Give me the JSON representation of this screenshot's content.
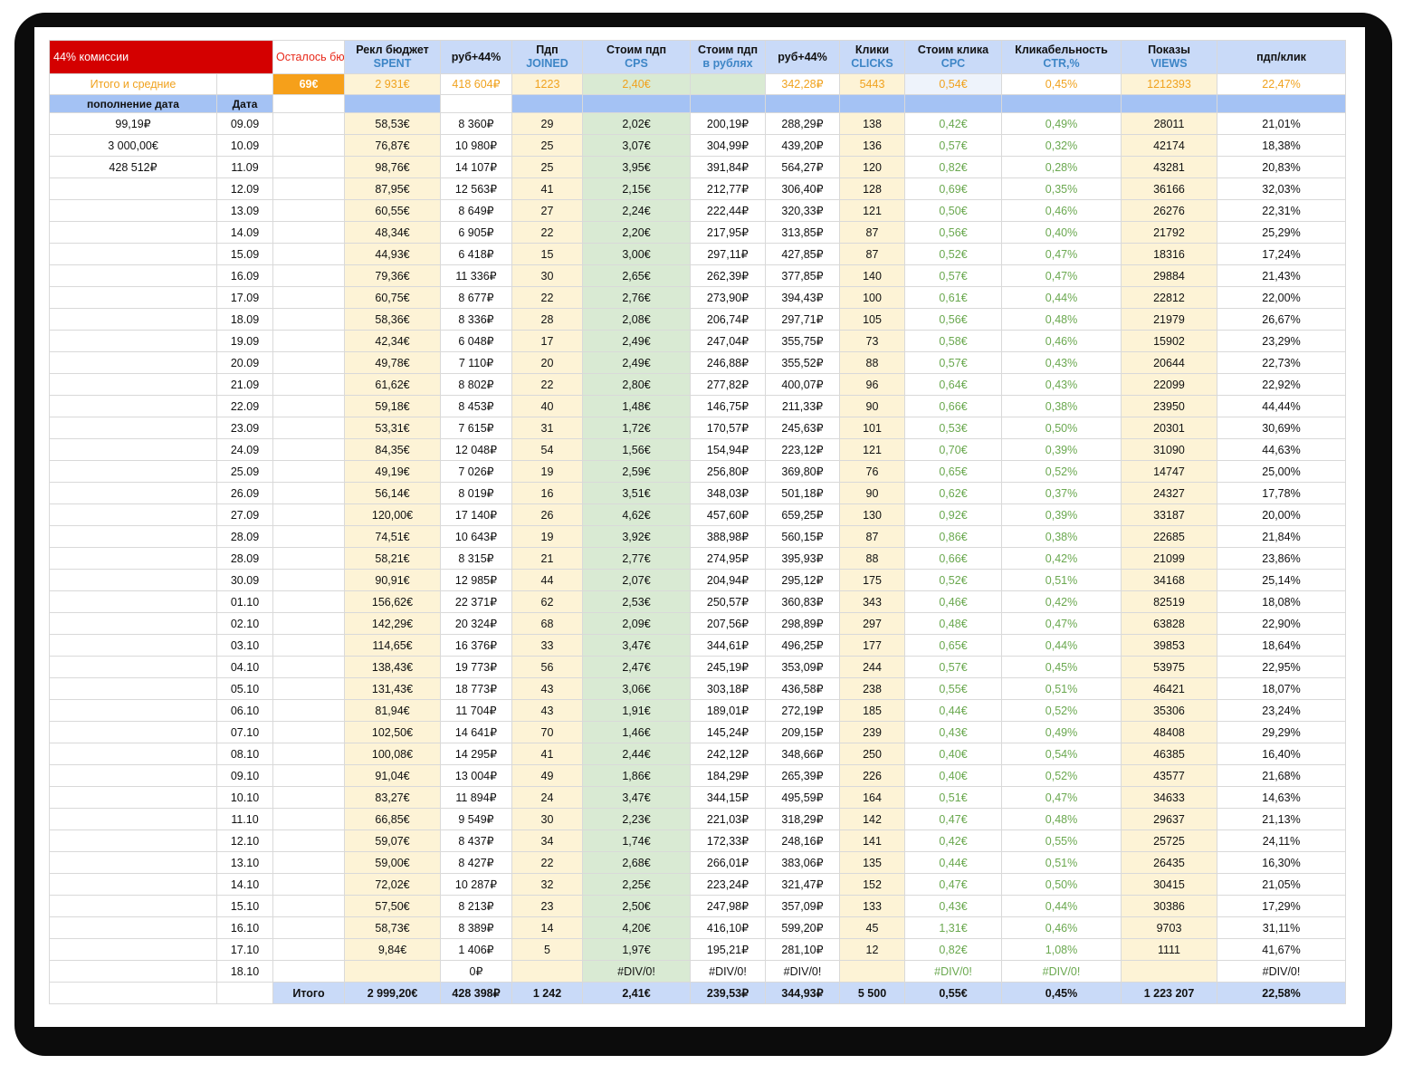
{
  "header": {
    "commission": "44% комиссии",
    "remain": "Осталось бюджета",
    "spent": {
      "ru": "Рекл бюджет",
      "en": "SPENT"
    },
    "rub44": "руб+44%",
    "joined": {
      "ru": "Пдп",
      "en": "JOINED"
    },
    "cps": {
      "ru": "Стоим пдп",
      "en": "CPS"
    },
    "cps_rub": {
      "ru": "Стоим пдп",
      "en": "в рублях"
    },
    "rub44b": "руб+44%",
    "clicks": {
      "ru": "Клики",
      "en": "CLICKS"
    },
    "cpc": {
      "ru": "Стоим клика",
      "en": "CPC"
    },
    "ctr": {
      "ru": "Кликабельность",
      "en": "CTR,%"
    },
    "views": {
      "ru": "Показы",
      "en": "VIEWS"
    },
    "per_click": "пдп/клик"
  },
  "totals_row": {
    "label": "Итого и средние",
    "remain": "69€",
    "spent": "2 931€",
    "rub44": "418 604₽",
    "joined": "1223",
    "cps": "2,40€",
    "cps_rub": "",
    "rub44b": "342,28₽",
    "clicks": "5443",
    "cpc": "0,54€",
    "ctr": "0,45%",
    "views": "1212393",
    "per_click": "22,47%"
  },
  "subheader": {
    "topup": "пополнение дата",
    "date": "Дата"
  },
  "topups": [
    "99,19₽",
    "3 000,00€",
    "428 512₽"
  ],
  "rows": [
    [
      "09.09",
      "58,53€",
      "8 360₽",
      "29",
      "2,02€",
      "200,19₽",
      "288,29₽",
      "138",
      "0,42€",
      "0,49%",
      "28011",
      "21,01%"
    ],
    [
      "10.09",
      "76,87€",
      "10 980₽",
      "25",
      "3,07€",
      "304,99₽",
      "439,20₽",
      "136",
      "0,57€",
      "0,32%",
      "42174",
      "18,38%"
    ],
    [
      "11.09",
      "98,76€",
      "14 107₽",
      "25",
      "3,95€",
      "391,84₽",
      "564,27₽",
      "120",
      "0,82€",
      "0,28%",
      "43281",
      "20,83%"
    ],
    [
      "12.09",
      "87,95€",
      "12 563₽",
      "41",
      "2,15€",
      "212,77₽",
      "306,40₽",
      "128",
      "0,69€",
      "0,35%",
      "36166",
      "32,03%"
    ],
    [
      "13.09",
      "60,55€",
      "8 649₽",
      "27",
      "2,24€",
      "222,44₽",
      "320,33₽",
      "121",
      "0,50€",
      "0,46%",
      "26276",
      "22,31%"
    ],
    [
      "14.09",
      "48,34€",
      "6 905₽",
      "22",
      "2,20€",
      "217,95₽",
      "313,85₽",
      "87",
      "0,56€",
      "0,40%",
      "21792",
      "25,29%"
    ],
    [
      "15.09",
      "44,93€",
      "6 418₽",
      "15",
      "3,00€",
      "297,11₽",
      "427,85₽",
      "87",
      "0,52€",
      "0,47%",
      "18316",
      "17,24%"
    ],
    [
      "16.09",
      "79,36€",
      "11 336₽",
      "30",
      "2,65€",
      "262,39₽",
      "377,85₽",
      "140",
      "0,57€",
      "0,47%",
      "29884",
      "21,43%"
    ],
    [
      "17.09",
      "60,75€",
      "8 677₽",
      "22",
      "2,76€",
      "273,90₽",
      "394,43₽",
      "100",
      "0,61€",
      "0,44%",
      "22812",
      "22,00%"
    ],
    [
      "18.09",
      "58,36€",
      "8 336₽",
      "28",
      "2,08€",
      "206,74₽",
      "297,71₽",
      "105",
      "0,56€",
      "0,48%",
      "21979",
      "26,67%"
    ],
    [
      "19.09",
      "42,34€",
      "6 048₽",
      "17",
      "2,49€",
      "247,04₽",
      "355,75₽",
      "73",
      "0,58€",
      "0,46%",
      "15902",
      "23,29%"
    ],
    [
      "20.09",
      "49,78€",
      "7 110₽",
      "20",
      "2,49€",
      "246,88₽",
      "355,52₽",
      "88",
      "0,57€",
      "0,43%",
      "20644",
      "22,73%"
    ],
    [
      "21.09",
      "61,62€",
      "8 802₽",
      "22",
      "2,80€",
      "277,82₽",
      "400,07₽",
      "96",
      "0,64€",
      "0,43%",
      "22099",
      "22,92%"
    ],
    [
      "22.09",
      "59,18€",
      "8 453₽",
      "40",
      "1,48€",
      "146,75₽",
      "211,33₽",
      "90",
      "0,66€",
      "0,38%",
      "23950",
      "44,44%"
    ],
    [
      "23.09",
      "53,31€",
      "7 615₽",
      "31",
      "1,72€",
      "170,57₽",
      "245,63₽",
      "101",
      "0,53€",
      "0,50%",
      "20301",
      "30,69%"
    ],
    [
      "24.09",
      "84,35€",
      "12 048₽",
      "54",
      "1,56€",
      "154,94₽",
      "223,12₽",
      "121",
      "0,70€",
      "0,39%",
      "31090",
      "44,63%"
    ],
    [
      "25.09",
      "49,19€",
      "7 026₽",
      "19",
      "2,59€",
      "256,80₽",
      "369,80₽",
      "76",
      "0,65€",
      "0,52%",
      "14747",
      "25,00%"
    ],
    [
      "26.09",
      "56,14€",
      "8 019₽",
      "16",
      "3,51€",
      "348,03₽",
      "501,18₽",
      "90",
      "0,62€",
      "0,37%",
      "24327",
      "17,78%"
    ],
    [
      "27.09",
      "120,00€",
      "17 140₽",
      "26",
      "4,62€",
      "457,60₽",
      "659,25₽",
      "130",
      "0,92€",
      "0,39%",
      "33187",
      "20,00%"
    ],
    [
      "28.09",
      "74,51€",
      "10 643₽",
      "19",
      "3,92€",
      "388,98₽",
      "560,15₽",
      "87",
      "0,86€",
      "0,38%",
      "22685",
      "21,84%"
    ],
    [
      "28.09",
      "58,21€",
      "8 315₽",
      "21",
      "2,77€",
      "274,95₽",
      "395,93₽",
      "88",
      "0,66€",
      "0,42%",
      "21099",
      "23,86%"
    ],
    [
      "30.09",
      "90,91€",
      "12 985₽",
      "44",
      "2,07€",
      "204,94₽",
      "295,12₽",
      "175",
      "0,52€",
      "0,51%",
      "34168",
      "25,14%"
    ],
    [
      "01.10",
      "156,62€",
      "22 371₽",
      "62",
      "2,53€",
      "250,57₽",
      "360,83₽",
      "343",
      "0,46€",
      "0,42%",
      "82519",
      "18,08%"
    ],
    [
      "02.10",
      "142,29€",
      "20 324₽",
      "68",
      "2,09€",
      "207,56₽",
      "298,89₽",
      "297",
      "0,48€",
      "0,47%",
      "63828",
      "22,90%"
    ],
    [
      "03.10",
      "114,65€",
      "16 376₽",
      "33",
      "3,47€",
      "344,61₽",
      "496,25₽",
      "177",
      "0,65€",
      "0,44%",
      "39853",
      "18,64%"
    ],
    [
      "04.10",
      "138,43€",
      "19 773₽",
      "56",
      "2,47€",
      "245,19₽",
      "353,09₽",
      "244",
      "0,57€",
      "0,45%",
      "53975",
      "22,95%"
    ],
    [
      "05.10",
      "131,43€",
      "18 773₽",
      "43",
      "3,06€",
      "303,18₽",
      "436,58₽",
      "238",
      "0,55€",
      "0,51%",
      "46421",
      "18,07%"
    ],
    [
      "06.10",
      "81,94€",
      "11 704₽",
      "43",
      "1,91€",
      "189,01₽",
      "272,19₽",
      "185",
      "0,44€",
      "0,52%",
      "35306",
      "23,24%"
    ],
    [
      "07.10",
      "102,50€",
      "14 641₽",
      "70",
      "1,46€",
      "145,24₽",
      "209,15₽",
      "239",
      "0,43€",
      "0,49%",
      "48408",
      "29,29%"
    ],
    [
      "08.10",
      "100,08€",
      "14 295₽",
      "41",
      "2,44€",
      "242,12₽",
      "348,66₽",
      "250",
      "0,40€",
      "0,54%",
      "46385",
      "16,40%"
    ],
    [
      "09.10",
      "91,04€",
      "13 004₽",
      "49",
      "1,86€",
      "184,29₽",
      "265,39₽",
      "226",
      "0,40€",
      "0,52%",
      "43577",
      "21,68%"
    ],
    [
      "10.10",
      "83,27€",
      "11 894₽",
      "24",
      "3,47€",
      "344,15₽",
      "495,59₽",
      "164",
      "0,51€",
      "0,47%",
      "34633",
      "14,63%"
    ],
    [
      "11.10",
      "66,85€",
      "9 549₽",
      "30",
      "2,23€",
      "221,03₽",
      "318,29₽",
      "142",
      "0,47€",
      "0,48%",
      "29637",
      "21,13%"
    ],
    [
      "12.10",
      "59,07€",
      "8 437₽",
      "34",
      "1,74€",
      "172,33₽",
      "248,16₽",
      "141",
      "0,42€",
      "0,55%",
      "25725",
      "24,11%"
    ],
    [
      "13.10",
      "59,00€",
      "8 427₽",
      "22",
      "2,68€",
      "266,01₽",
      "383,06₽",
      "135",
      "0,44€",
      "0,51%",
      "26435",
      "16,30%"
    ],
    [
      "14.10",
      "72,02€",
      "10 287₽",
      "32",
      "2,25€",
      "223,24₽",
      "321,47₽",
      "152",
      "0,47€",
      "0,50%",
      "30415",
      "21,05%"
    ],
    [
      "15.10",
      "57,50€",
      "8 213₽",
      "23",
      "2,50€",
      "247,98₽",
      "357,09₽",
      "133",
      "0,43€",
      "0,44%",
      "30386",
      "17,29%"
    ],
    [
      "16.10",
      "58,73€",
      "8 389₽",
      "14",
      "4,20€",
      "416,10₽",
      "599,20₽",
      "45",
      "1,31€",
      "0,46%",
      "9703",
      "31,11%"
    ],
    [
      "17.10",
      "9,84€",
      "1 406₽",
      "5",
      "1,97€",
      "195,21₽",
      "281,10₽",
      "12",
      "0,82€",
      "1,08%",
      "1111",
      "41,67%"
    ],
    [
      "18.10",
      "",
      "0₽",
      "",
      "#DIV/0!",
      "#DIV/0!",
      "#DIV/0!",
      "",
      "#DIV/0!",
      "#DIV/0!",
      "",
      "#DIV/0!"
    ]
  ],
  "footer": {
    "label": "Итого",
    "spent": "2 999,20€",
    "rub44": "428 398₽",
    "joined": "1 242",
    "cps": "2,41€",
    "cps_rub": "239,53₽",
    "rub44b": "344,93₽",
    "clicks": "5 500",
    "cpc": "0,55€",
    "ctr": "0,45%",
    "views": "1 223 207",
    "per_click": "22,58%"
  }
}
